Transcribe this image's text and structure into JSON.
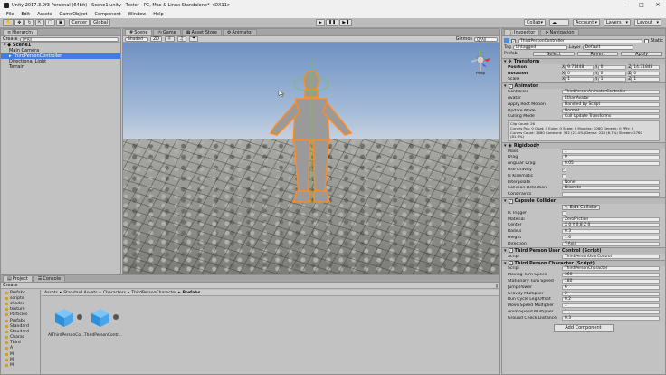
{
  "window": {
    "title": "Unity 2017.3.0f3 Personal (64bit) - Scene1.unity - Tester - PC, Mac & Linux Standalone* <DX11>"
  },
  "menu": [
    "File",
    "Edit",
    "Assets",
    "GameObject",
    "Component",
    "Window",
    "Help"
  ],
  "toolbar": {
    "center": "Center",
    "global": "Global",
    "collab": "Collab",
    "account": "Account",
    "layers": "Layers",
    "layout": "Layout"
  },
  "hierarchy": {
    "tab": "Hierarchy",
    "create": "Create",
    "search_placeholder": "Q*All",
    "scene": "Scene1",
    "items": [
      "Main Camera",
      "ThirdPersonController",
      "Directional Light",
      "Terrain"
    ]
  },
  "scene": {
    "tabs": [
      "Scene",
      "Game",
      "Asset Store",
      "Animator"
    ],
    "shading": "Shaded",
    "mode": "2D",
    "gizmos": "Gizmos",
    "search": "Q*All",
    "view": "Persp"
  },
  "inspector": {
    "tabs": [
      "Inspector",
      "Navigation"
    ],
    "object": {
      "name": "ThirdPersonController",
      "static": "Static",
      "tag_label": "Tag",
      "tag": "Untagged",
      "layer_label": "Layer",
      "layer": "Default",
      "prefab_label": "Prefab",
      "select": "Select",
      "revert": "Revert",
      "apply": "Apply"
    },
    "transform": {
      "title": "Transform",
      "position": {
        "label": "Position",
        "x": "9.71448",
        "y": "0",
        "z": "14.31848"
      },
      "rotation": {
        "label": "Rotation",
        "x": "0",
        "y": "0",
        "z": "0"
      },
      "scale": {
        "label": "Scale",
        "x": "1",
        "y": "1",
        "z": "1"
      }
    },
    "animator": {
      "title": "Animator",
      "rows": [
        [
          "Controller",
          "ThirdPersonAnimatorController"
        ],
        [
          "Avatar",
          "EthanAvatar"
        ],
        [
          "Apply Root Motion",
          "Handled by Script"
        ],
        [
          "Update Mode",
          "Normal"
        ],
        [
          "Culling Mode",
          "Cull Update Transforms"
        ]
      ],
      "info": [
        "Clip Count: 26",
        "Curves Pos: 0 Quat: 0 Euler: 0 Scale: 0 Muscles: 2080 Generic: 0 PPtr: 0",
        "Curves Count: 2080 Constant: 392 (21.4%) Dense: 228 (6.7%) Stream: 2760 (81.9%)"
      ]
    },
    "rigidbody": {
      "title": "Rigidbody",
      "rows": [
        [
          "Mass",
          "1"
        ],
        [
          "Drag",
          "0"
        ],
        [
          "Angular Drag",
          "0.05"
        ],
        [
          "Use Gravity",
          "true"
        ],
        [
          "Is Kinematic",
          "false"
        ],
        [
          "Interpolate",
          "None"
        ],
        [
          "Collision Detection",
          "Discrete"
        ],
        [
          "Constraints",
          ""
        ]
      ]
    },
    "capsule": {
      "title": "Capsule Collider",
      "edit": "Edit Collider",
      "rows": [
        [
          "Is Trigger",
          "false"
        ],
        [
          "Material",
          "ZeroFriction"
        ],
        [
          "Center",
          "X 0   Y 0.8   Z 0"
        ],
        [
          "Radius",
          "0.3"
        ],
        [
          "Height",
          "1.6"
        ],
        [
          "Direction",
          "Y-Axis"
        ]
      ]
    },
    "user_control": {
      "title": "Third Person User Control (Script)",
      "script": "ThirdPersonUserControl"
    },
    "character": {
      "title": "Third Person Character (Script)",
      "script": "ThirdPersonCharacter",
      "rows": [
        [
          "Moving Turn Speed",
          "360"
        ],
        [
          "Stationary Turn Speed",
          "180"
        ],
        [
          "Jump Power",
          "6"
        ],
        [
          "Gravity Multiplier",
          "2"
        ],
        [
          "Run Cycle Leg Offset",
          "0.2"
        ],
        [
          "Move Speed Multiplier",
          "1"
        ],
        [
          "Anim Speed Multiplier",
          "1"
        ],
        [
          "Ground Check Distance",
          "0.3"
        ]
      ]
    },
    "add_component": "Add Component"
  },
  "project": {
    "tabs": [
      "Project",
      "Console"
    ],
    "create": "Create",
    "breadcrumb": [
      "Assets",
      "Standard Assets",
      "Characters",
      "ThirdPersonCharacter",
      "Prefabs"
    ],
    "tree": [
      "Prefabs",
      "scripts",
      "shader",
      "texture",
      "Particles",
      "Prefabs",
      "Standard",
      "Standard",
      "Charac",
      "Third",
      "A",
      "M",
      "M",
      "M"
    ],
    "assets": [
      "AIThirdPersonCo...",
      "ThirdPersonContr..."
    ]
  }
}
